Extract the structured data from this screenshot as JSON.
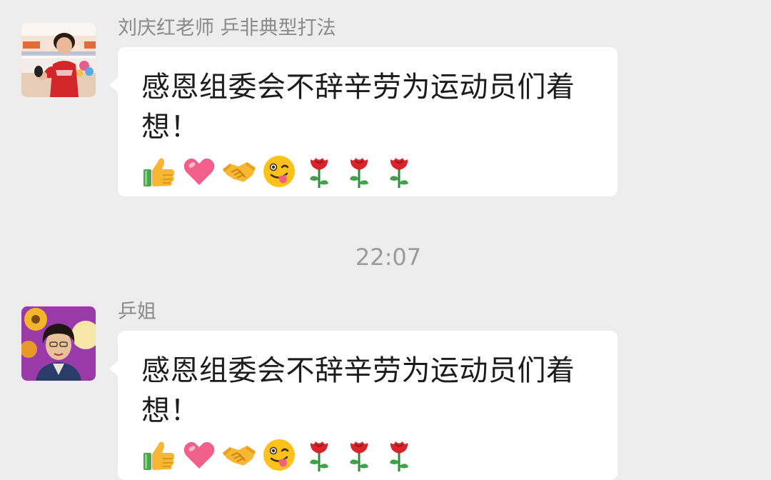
{
  "messages": [
    {
      "sender": "刘庆红老师 乒非典型打法",
      "text": "感恩组委会不辞辛劳为运动员们着想！",
      "emojis": [
        "thumbs-up",
        "heart",
        "handshake",
        "winking-tongue-face",
        "rose",
        "rose",
        "rose"
      ]
    },
    {
      "sender": "乒姐",
      "text": "感恩组委会不辞辛劳为运动员们着想！",
      "emojis": [
        "thumbs-up",
        "heart",
        "handshake",
        "winking-tongue-face",
        "rose",
        "rose",
        "rose"
      ]
    }
  ],
  "timestamp": "22:07",
  "colors": {
    "background": "#ededed",
    "bubble": "#ffffff",
    "sender_text": "#8a8a8a",
    "message_text": "#1c1c1c",
    "timestamp_text": "#9b9b9b"
  }
}
